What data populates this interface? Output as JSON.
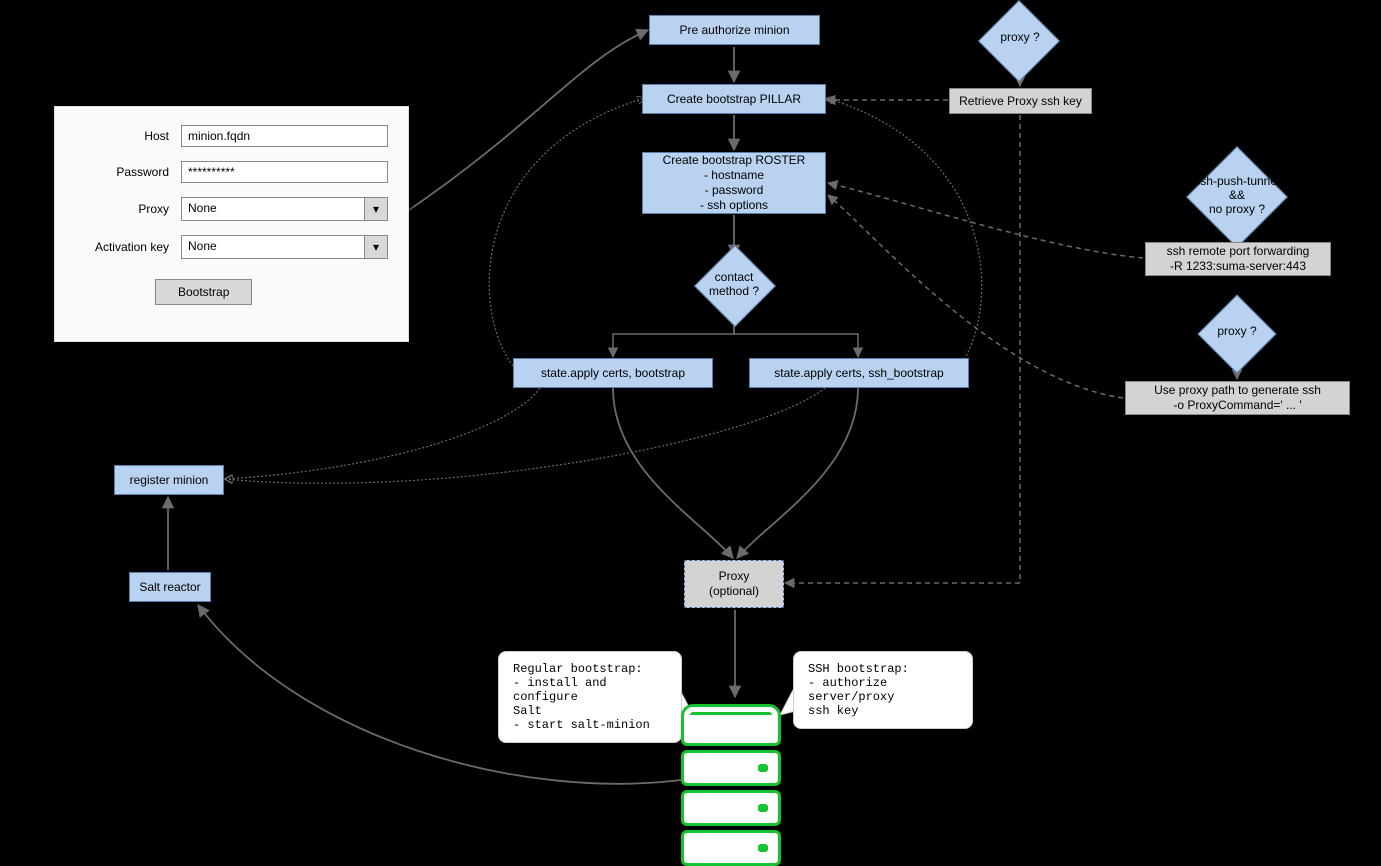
{
  "form": {
    "labels": {
      "host": "Host",
      "password": "Password",
      "proxy": "Proxy",
      "activation_key": "Activation key"
    },
    "values": {
      "host": "minion.fqdn",
      "password": "**********",
      "proxy": "None",
      "activation_key": "None"
    },
    "button": "Bootstrap"
  },
  "nodes": {
    "pre_authorize": "Pre authorize minion",
    "create_pillar": "Create bootstrap PILLAR",
    "create_roster": "Create bootstrap ROSTER\n- hostname\n- password\n- ssh options",
    "contact_method": "contact\nmethod ?",
    "apply_bootstrap": "state.apply certs, bootstrap",
    "apply_ssh_bootstrap": "state.apply certs, ssh_bootstrap",
    "proxy_q1": "proxy ?",
    "retrieve_proxy_key": "Retrieve Proxy ssh key",
    "ssh_push_tunnel": "ssh-push-tunnel\n&&\nno proxy ?",
    "ssh_remote_port": "ssh remote port forwarding\n-R 1233:suma-server:443",
    "proxy_q2": "proxy ?",
    "use_proxy_path": "Use proxy path to generate ssh\n-o ProxyCommand=' ... '",
    "proxy_optional": "Proxy\n(optional)",
    "register_minion": "register minion",
    "salt_reactor": "Salt reactor"
  },
  "notes": {
    "regular": "Regular bootstrap:\n- install and configure\n    Salt\n- start salt-minion",
    "ssh": "SSH bootstrap:\n- authorize server/proxy\n    ssh key"
  }
}
